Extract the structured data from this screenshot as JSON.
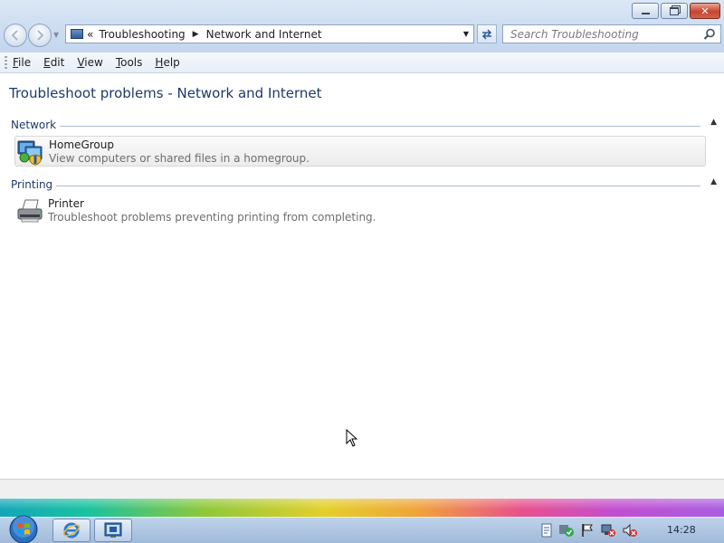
{
  "window": {
    "minimize_icon": "minimize-icon",
    "maximize_icon": "restore-icon",
    "close_icon": "close-icon"
  },
  "navigation": {
    "back_icon": "back-arrow-icon",
    "forward_icon": "forward-arrow-icon"
  },
  "address_bar": {
    "overflow_symbol": "«",
    "breadcrumbs": [
      "Troubleshooting",
      "Network and Internet"
    ],
    "separator_icon": "chevron-right-icon",
    "dropdown_icon": "chevron-down-icon",
    "refresh_icon": "refresh-icon"
  },
  "search": {
    "placeholder": "Search Troubleshooting",
    "icon": "search-icon"
  },
  "menu": {
    "items": [
      {
        "label_u": "F",
        "label_rest": "ile"
      },
      {
        "label_u": "E",
        "label_rest": "dit"
      },
      {
        "label_u": "V",
        "label_rest": "iew"
      },
      {
        "label_u": "T",
        "label_rest": "ools"
      },
      {
        "label_u": "H",
        "label_rest": "elp"
      }
    ]
  },
  "main": {
    "title": "Troubleshoot problems - Network and Internet",
    "sections": [
      {
        "label": "Network",
        "items": [
          {
            "title": "HomeGroup",
            "description": "View computers or shared files in a homegroup.",
            "icon": "homegroup-icon"
          }
        ]
      },
      {
        "label": "Printing",
        "items": [
          {
            "title": "Printer",
            "description": "Troubleshoot problems preventing printing from completing.",
            "icon": "printer-icon"
          }
        ]
      }
    ]
  },
  "taskbar": {
    "start_icon": "windows-start-orb-icon",
    "pinned": [
      "internet-explorer-icon",
      "troubleshooting-window-icon"
    ],
    "tray_icons": [
      "document-icon",
      "security-check-icon",
      "action-center-flag-icon",
      "network-error-icon",
      "volume-muted-icon"
    ],
    "clock": "14:28"
  },
  "colors": {
    "title_blue": "#1e3a6a",
    "description_gray": "#6e6e6e",
    "taskbar_blue": "#9fb9d9"
  }
}
